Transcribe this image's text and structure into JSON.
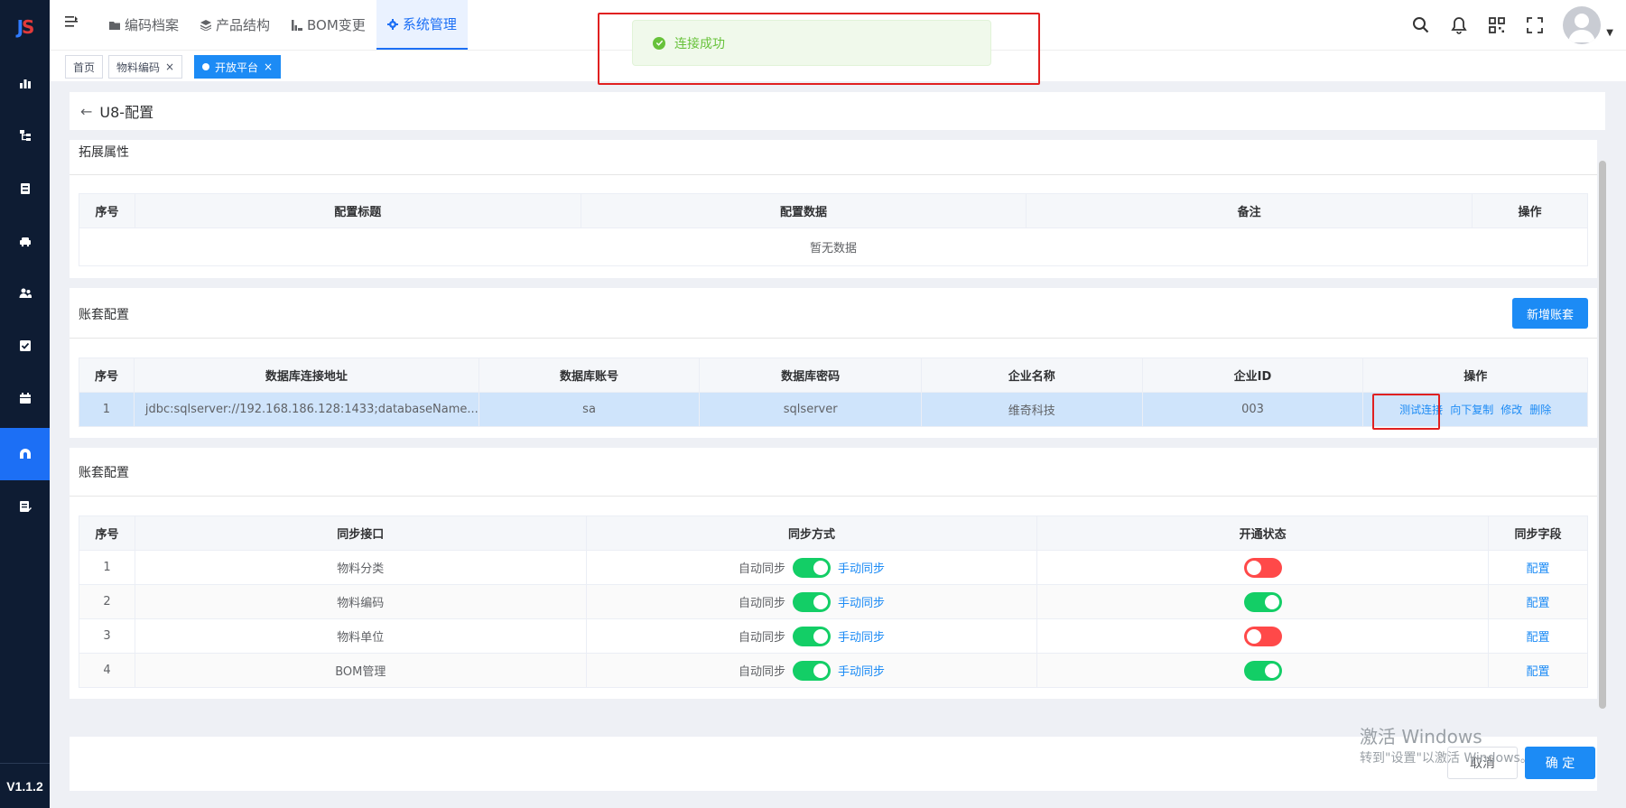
{
  "sidebar": {
    "logo": "JS",
    "version": "V1.1.2",
    "items": [
      {
        "icon": "bar-chart-icon"
      },
      {
        "icon": "tree-structure-icon"
      },
      {
        "icon": "id-card-icon"
      },
      {
        "icon": "car-icon"
      },
      {
        "icon": "users-icon"
      },
      {
        "icon": "check-square-icon"
      },
      {
        "icon": "calendar-icon"
      },
      {
        "icon": "platform-icon",
        "active": true
      },
      {
        "icon": "document-edit-icon"
      }
    ]
  },
  "header": {
    "nav": [
      {
        "label": "编码档案",
        "icon": "folder-icon"
      },
      {
        "label": "产品结构",
        "icon": "layers-icon"
      },
      {
        "label": "BOM变更",
        "icon": "chart-icon"
      },
      {
        "label": "系统管理",
        "icon": "gear-icon",
        "active": true
      }
    ]
  },
  "tags": [
    {
      "label": "首页"
    },
    {
      "label": "物料编码",
      "close": "×"
    },
    {
      "label": "开放平台",
      "close": "×",
      "active": true
    }
  ],
  "toast": {
    "message": "连接成功"
  },
  "page": {
    "back_arrow": "←",
    "title": "U8-配置"
  },
  "ext_panel": {
    "title": "拓展属性",
    "columns": [
      "序号",
      "配置标题",
      "配置数据",
      "备注",
      "操作"
    ],
    "empty_text": "暂无数据"
  },
  "account_panel": {
    "title": "账套配置",
    "add_button": "新增账套",
    "columns": [
      "序号",
      "数据库连接地址",
      "数据库账号",
      "数据库密码",
      "企业名称",
      "企业ID",
      "操作"
    ],
    "rows": [
      {
        "index": "1",
        "url": "jdbc:sqlserver://192.168.186.128:1433;databaseName...",
        "account": "sa",
        "password": "sqlserver",
        "company": "维奇科技",
        "company_id": "003",
        "ops": [
          "测试连接",
          "向下复制",
          "修改",
          "删除"
        ]
      }
    ]
  },
  "sync_panel": {
    "title": "账套配置",
    "columns": [
      "序号",
      "同步接口",
      "同步方式",
      "开通状态",
      "同步字段"
    ],
    "auto_label": "自动同步",
    "manual_label": "手动同步",
    "config_label": "配置",
    "rows": [
      {
        "index": "1",
        "name": "物料分类",
        "auto": "on",
        "status": "off"
      },
      {
        "index": "2",
        "name": "物料编码",
        "auto": "on",
        "status": "on"
      },
      {
        "index": "3",
        "name": "物料单位",
        "auto": "on",
        "status": "off"
      },
      {
        "index": "4",
        "name": "BOM管理",
        "auto": "on",
        "status": "on"
      }
    ]
  },
  "footer": {
    "cancel": "取消",
    "confirm": "确 定"
  },
  "watermark": {
    "line1": "激活 Windows",
    "line2": "转到\"设置\"以激活 Windows。"
  }
}
